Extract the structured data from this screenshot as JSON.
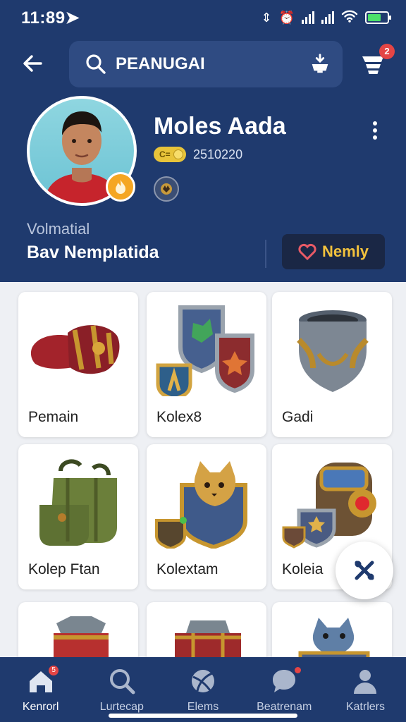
{
  "status_bar": {
    "time": "11:89"
  },
  "search": {
    "value": "PEANUGAI",
    "placeholder": "PEANUGAI"
  },
  "cart": {
    "badge": "2"
  },
  "profile": {
    "name": "Moles Aada",
    "coin_label": "C=",
    "coin_value": "2510220",
    "sub_label": "Volmatial",
    "sub_title": "Bav Nemplatida"
  },
  "notify_button": {
    "label": "Nemly"
  },
  "grid_items": [
    {
      "label": "Pemain",
      "icon": "gauntlet-icon"
    },
    {
      "label": "Kolex8",
      "icon": "shields-icon"
    },
    {
      "label": "Gadi",
      "icon": "armor-shield-icon"
    },
    {
      "label": "Kolep Ftan",
      "icon": "backpack-icon"
    },
    {
      "label": "Kolextam",
      "icon": "fox-shield-icon"
    },
    {
      "label": "Koleia",
      "icon": "gear-gauntlet-icon"
    },
    {
      "label": "",
      "icon": "red-armor-icon"
    },
    {
      "label": "",
      "icon": "red-backpack-icon"
    },
    {
      "label": "",
      "icon": "blue-creature-icon"
    }
  ],
  "bottom_nav": [
    {
      "label": "Kenrorl",
      "icon": "home-icon",
      "badge": "5"
    },
    {
      "label": "Lurtecap",
      "icon": "search-icon"
    },
    {
      "label": "Elems",
      "icon": "ball-icon"
    },
    {
      "label": "Beatrenam",
      "icon": "chat-icon"
    },
    {
      "label": "Katrlers",
      "icon": "profile-icon"
    }
  ],
  "colors": {
    "header": "#1f3a6e",
    "accent": "#f2c23d",
    "badge": "#e44545"
  }
}
